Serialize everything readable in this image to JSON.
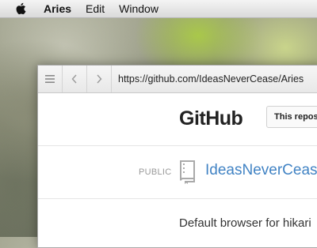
{
  "menubar": {
    "apple_icon": "apple-logo-icon",
    "app_name": "Aries",
    "items": [
      {
        "label": "Edit"
      },
      {
        "label": "Window"
      }
    ]
  },
  "browser": {
    "toolbar": {
      "menu_icon": "hamburger-icon",
      "back_icon": "chevron-left-icon",
      "forward_icon": "chevron-right-icon",
      "url": "https://github.com/IdeasNeverCease/Aries"
    }
  },
  "github": {
    "logo_text": "GitHub",
    "search_placeholder": "This repos",
    "repo": {
      "visibility": "PUBLIC",
      "icon": "repo-book-icon",
      "name": "IdeasNeverCeas"
    },
    "description": "Default browser for hikari"
  },
  "colors": {
    "link": "#4183c4",
    "menubar": "#e6e6e6"
  }
}
